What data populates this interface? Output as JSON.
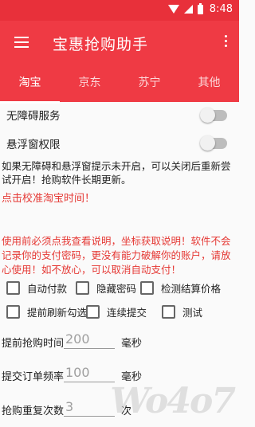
{
  "status": {
    "time": "8:48"
  },
  "appbar": {
    "title": "宝惠抢购助手"
  },
  "tabs": [
    {
      "label": "淘宝",
      "active": true
    },
    {
      "label": "京东",
      "active": false
    },
    {
      "label": "苏宁",
      "active": false
    },
    {
      "label": "其他",
      "active": false
    }
  ],
  "settings": {
    "accessibility": {
      "label": "无障碍服务",
      "on": false
    },
    "overlay": {
      "label": "悬浮窗权限",
      "on": false
    }
  },
  "notes": {
    "restart_hint": "如果无障碍和悬浮窗提示未开启，可以关闭后重新尝试开启！抢购软件长期更新。",
    "calibrate": "点击校准淘宝时间！",
    "warning": "使用前必须点我查看说明，坐标获取说明！软件不会记录你的支付密码，更没有能力破解你的账户，请放心使用！如不放心，可以取消自动支付！"
  },
  "options": [
    {
      "label": "自动付款",
      "checked": false
    },
    {
      "label": "隐藏密码",
      "checked": false
    },
    {
      "label": "检测结算价格",
      "checked": false
    },
    {
      "label": "提前刷新勾选",
      "checked": false
    },
    {
      "label": "连续提交",
      "checked": false
    },
    {
      "label": "测试",
      "checked": false
    }
  ],
  "fields": {
    "advance_time": {
      "label": "提前抢购时间",
      "value": "200",
      "unit": "毫秒"
    },
    "submit_freq": {
      "label": "提交订单频率",
      "value": "100",
      "unit": "毫秒"
    },
    "retry_count": {
      "label": "抢购重复次数",
      "value": "3",
      "unit": "次"
    }
  },
  "colors": {
    "primary": "#ef3a44",
    "statusbar": "#e8303a",
    "alert": "#e53935"
  },
  "icons": {
    "menu": "hamburger-icon",
    "overflow": "more-vert-icon"
  }
}
